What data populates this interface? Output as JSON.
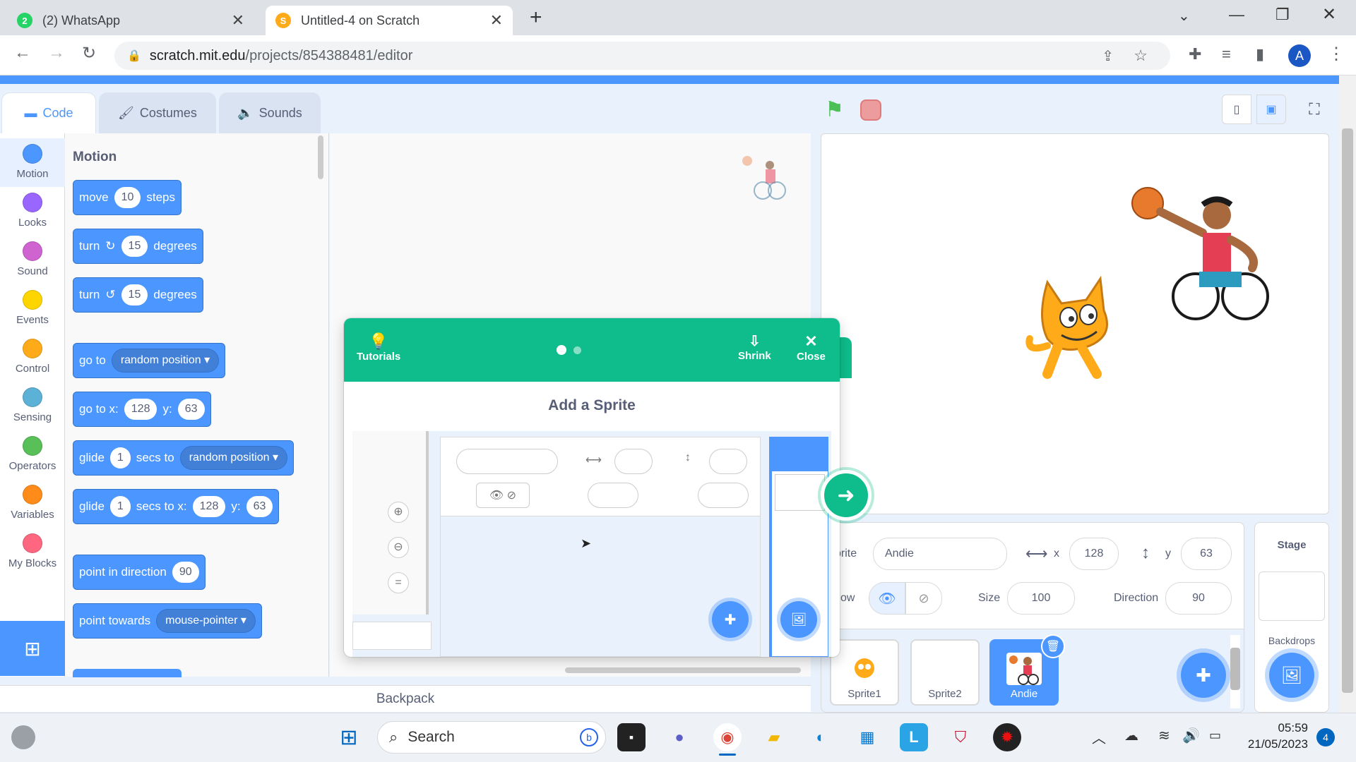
{
  "browser": {
    "tabs": [
      {
        "title": "(2) WhatsApp",
        "badge": "2"
      },
      {
        "title": "Untitled-4 on Scratch"
      }
    ],
    "url_domain": "scratch.mit.edu",
    "url_path": "/projects/854388481/editor",
    "profile_initial": "A"
  },
  "editor": {
    "tabs": [
      "Code",
      "Costumes",
      "Sounds"
    ],
    "categories": [
      {
        "label": "Motion",
        "color": "#4c97ff"
      },
      {
        "label": "Looks",
        "color": "#9966ff"
      },
      {
        "label": "Sound",
        "color": "#cf63cf"
      },
      {
        "label": "Events",
        "color": "#ffd500"
      },
      {
        "label": "Control",
        "color": "#ffab19"
      },
      {
        "label": "Sensing",
        "color": "#5cb1d6"
      },
      {
        "label": "Operators",
        "color": "#59c059"
      },
      {
        "label": "Variables",
        "color": "#ff8c1a"
      },
      {
        "label": "My Blocks",
        "color": "#ff6680"
      }
    ],
    "palette_heading": "Motion",
    "blocks": {
      "move": {
        "pre": "move",
        "val": "10",
        "post": "steps"
      },
      "turn_cw": {
        "pre": "turn",
        "val": "15",
        "post": "degrees"
      },
      "turn_ccw": {
        "pre": "turn",
        "val": "15",
        "post": "degrees"
      },
      "goto": {
        "pre": "go to",
        "drop": "random position"
      },
      "gotoxy": {
        "pre": "go to x:",
        "x": "128",
        "ylab": "y:",
        "y": "63"
      },
      "glide": {
        "pre": "glide",
        "val": "1",
        "mid": "secs to",
        "drop": "random position"
      },
      "glidexy": {
        "pre": "glide",
        "val": "1",
        "mid": "secs to x:",
        "x": "128",
        "ylab": "y:",
        "y": "63"
      },
      "point_dir": {
        "pre": "point in direction",
        "val": "90"
      },
      "point_towards": {
        "pre": "point towards",
        "drop": "mouse-pointer"
      }
    },
    "backpack": "Backpack"
  },
  "tutorial": {
    "tutorials_label": "Tutorials",
    "shrink_label": "Shrink",
    "close_label": "Close",
    "title": "Add a Sprite"
  },
  "sprite_info": {
    "sprite_label": "prite",
    "name": "Andie",
    "x_label": "x",
    "x": "128",
    "y_label": "y",
    "y": "63",
    "show_label": "ow",
    "size_label": "Size",
    "size": "100",
    "direction_label": "Direction",
    "direction": "90"
  },
  "sprites": [
    "Sprite1",
    "Sprite2",
    "Andie"
  ],
  "stage_panel": {
    "title": "Stage",
    "backdrops": "Backdrops"
  },
  "taskbar": {
    "search": "Search",
    "time": "05:59",
    "date": "21/05/2023",
    "notif": "4"
  }
}
